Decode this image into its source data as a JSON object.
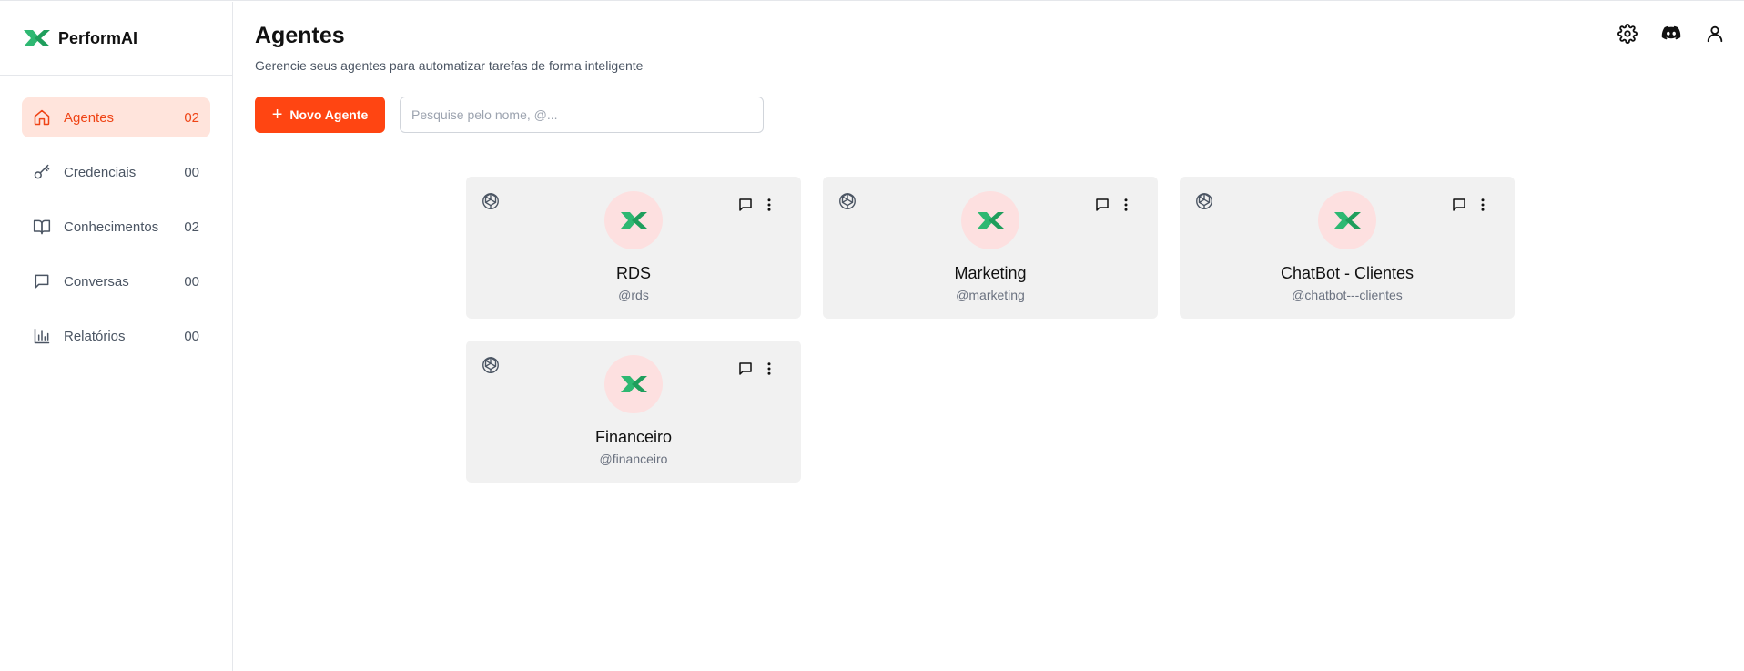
{
  "brand": {
    "name": "PerformAI",
    "logo_icon": "performai-logo-icon"
  },
  "sidebar": {
    "items": [
      {
        "label": "Agentes",
        "count": "02",
        "icon": "home-icon",
        "active": true
      },
      {
        "label": "Credenciais",
        "count": "00",
        "icon": "key-icon",
        "active": false
      },
      {
        "label": "Conhecimentos",
        "count": "02",
        "icon": "book-icon",
        "active": false
      },
      {
        "label": "Conversas",
        "count": "00",
        "icon": "message-icon",
        "active": false
      },
      {
        "label": "Relatórios",
        "count": "00",
        "icon": "bar-chart-icon",
        "active": false
      }
    ]
  },
  "header": {
    "title": "Agentes",
    "subtitle": "Gerencie seus agentes para automatizar tarefas de forma inteligente",
    "icons": [
      "gear-icon",
      "discord-icon",
      "user-icon"
    ]
  },
  "toolbar": {
    "new_button_label": "Novo Agente",
    "search_placeholder": "Pesquise pelo nome, @..."
  },
  "agents": [
    {
      "name": "RDS",
      "handle": "@rds"
    },
    {
      "name": "Marketing",
      "handle": "@marketing"
    },
    {
      "name": "ChatBot - Clientes",
      "handle": "@chatbot---clientes"
    },
    {
      "name": "Financeiro",
      "handle": "@financeiro"
    }
  ],
  "colors": {
    "accent": "#ff4512",
    "active_bg": "#ffe4dc",
    "card_bg": "#f1f1f1",
    "avatar_bg": "#fde0e0",
    "logo_green": "#2eb872"
  }
}
